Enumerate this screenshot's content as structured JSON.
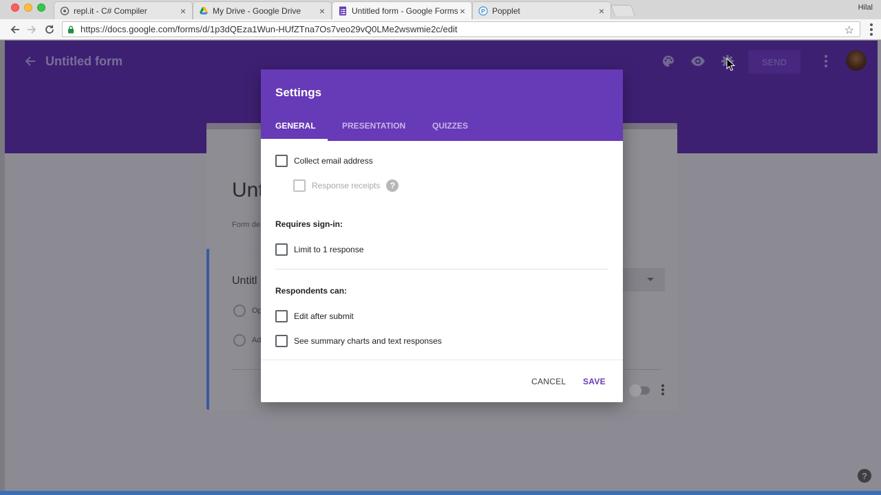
{
  "browser": {
    "tabs": [
      {
        "title": "repl.it - C# Compiler",
        "icon": "replit-icon"
      },
      {
        "title": "My Drive - Google Drive",
        "icon": "google-drive-icon"
      },
      {
        "title": "Untitled form - Google Forms",
        "icon": "google-forms-icon",
        "active": true
      },
      {
        "title": "Popplet",
        "icon": "popplet-icon"
      }
    ],
    "profile_name": "Hilal",
    "url": "https://docs.google.com/forms/d/1p3dQEza1Wun-HUfZTna7Os7veo29vQ0LMe2wswmie2c/edit"
  },
  "forms_header": {
    "title": "Untitled form",
    "send_label": "SEND",
    "icons": [
      "palette-icon",
      "preview-eye-icon",
      "settings-gear-icon"
    ]
  },
  "form": {
    "title_fragment": "Unt",
    "description_fragment": "Form de",
    "question_fragment": "Untitl",
    "option_fragments": [
      "Op",
      "Ad"
    ]
  },
  "settings": {
    "title": "Settings",
    "tabs": [
      "GENERAL",
      "PRESENTATION",
      "QUIZZES"
    ],
    "active_tab": "GENERAL",
    "collect_email": {
      "label": "Collect email address",
      "checked": false
    },
    "response_receipts": {
      "label": "Response receipts",
      "checked": false,
      "disabled": true,
      "help": "?"
    },
    "requires_signin": {
      "heading": "Requires sign-in:",
      "limit_one": {
        "label": "Limit to 1 response",
        "checked": false
      }
    },
    "respondents_can": {
      "heading": "Respondents can:",
      "edit_after_submit": {
        "label": "Edit after submit",
        "checked": false
      },
      "see_summary": {
        "label": "See summary charts and text responses",
        "checked": false
      }
    },
    "buttons": {
      "cancel": "CANCEL",
      "save": "SAVE"
    }
  },
  "help_label": "?",
  "colors": {
    "forms_purple": "#673ab7",
    "header_dimmed": "#3e2073",
    "overlay_gray": "#8c8b93"
  }
}
